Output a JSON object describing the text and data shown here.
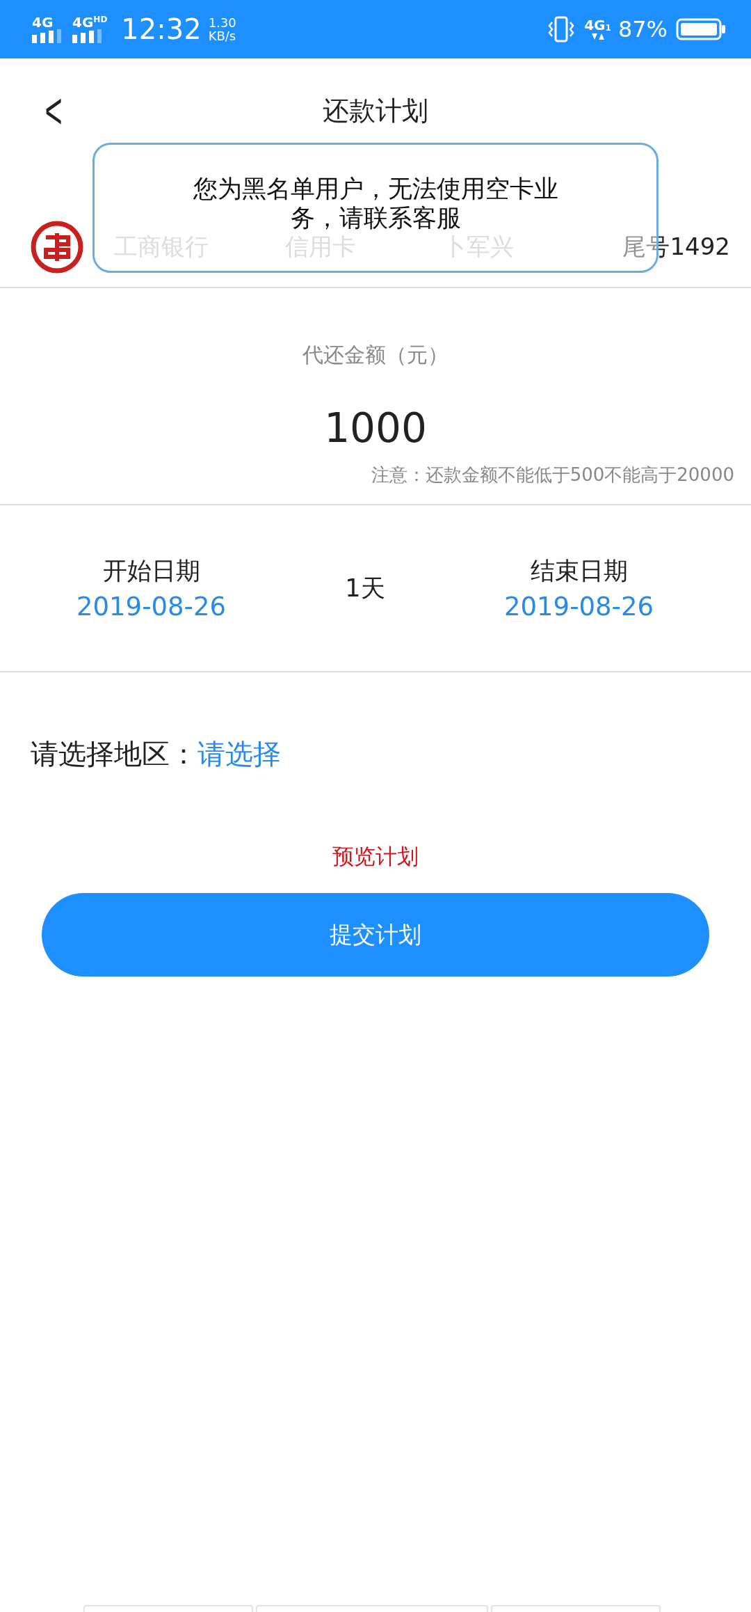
{
  "status_bar": {
    "network_1": "4G",
    "network_2": "4G",
    "network_2_sup": "HD",
    "time": "12:32",
    "speed": "1.30",
    "speed_unit": "KB/s",
    "network_3": "4G",
    "network_3_sub": "1",
    "battery": "87%"
  },
  "header": {
    "back": "<",
    "title": "还款计划"
  },
  "card": {
    "bank": "工商银行",
    "type": "信用卡",
    "holder": "卜军兴",
    "tail": "尾号1492"
  },
  "toast": {
    "message": "您为黑名单用户，无法使用空卡业务，请联系客服"
  },
  "amount": {
    "label": "代还金额（元）",
    "value": "1000",
    "note": "注意：还款金额不能低于500不能高于20000"
  },
  "dates": {
    "start_label": "开始日期",
    "start": "2019-08-26",
    "days": "1天",
    "end_label": "结束日期",
    "end": "2019-08-26"
  },
  "region": {
    "label": "请选择地区：",
    "placeholder": "请选择"
  },
  "preview": "预览计划",
  "submit": "提交计划"
}
